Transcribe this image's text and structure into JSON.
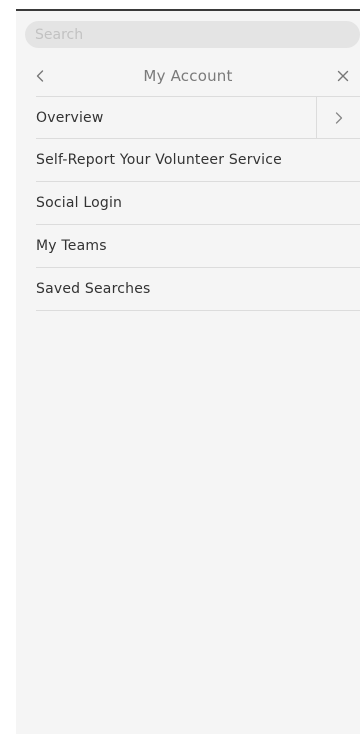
{
  "search": {
    "placeholder": "Search",
    "value": ""
  },
  "header": {
    "title": "My Account",
    "back_icon": "chevron-left-icon",
    "close_icon": "close-icon"
  },
  "menu": {
    "items": [
      {
        "label": "Overview",
        "has_submenu": true,
        "submenu_icon": "chevron-right-icon"
      },
      {
        "label": "Self-Report Your Volunteer Service",
        "has_submenu": false
      },
      {
        "label": "Social Login",
        "has_submenu": false
      },
      {
        "label": "My Teams",
        "has_submenu": false
      },
      {
        "label": "Saved Searches",
        "has_submenu": false
      }
    ]
  },
  "colors": {
    "panel_background": "#f5f5f5",
    "search_background": "#e4e4e4",
    "divider": "#dcdcdc",
    "text": "#333333",
    "muted_text": "#7a7a7a",
    "top_border": "#3a3a3a"
  }
}
